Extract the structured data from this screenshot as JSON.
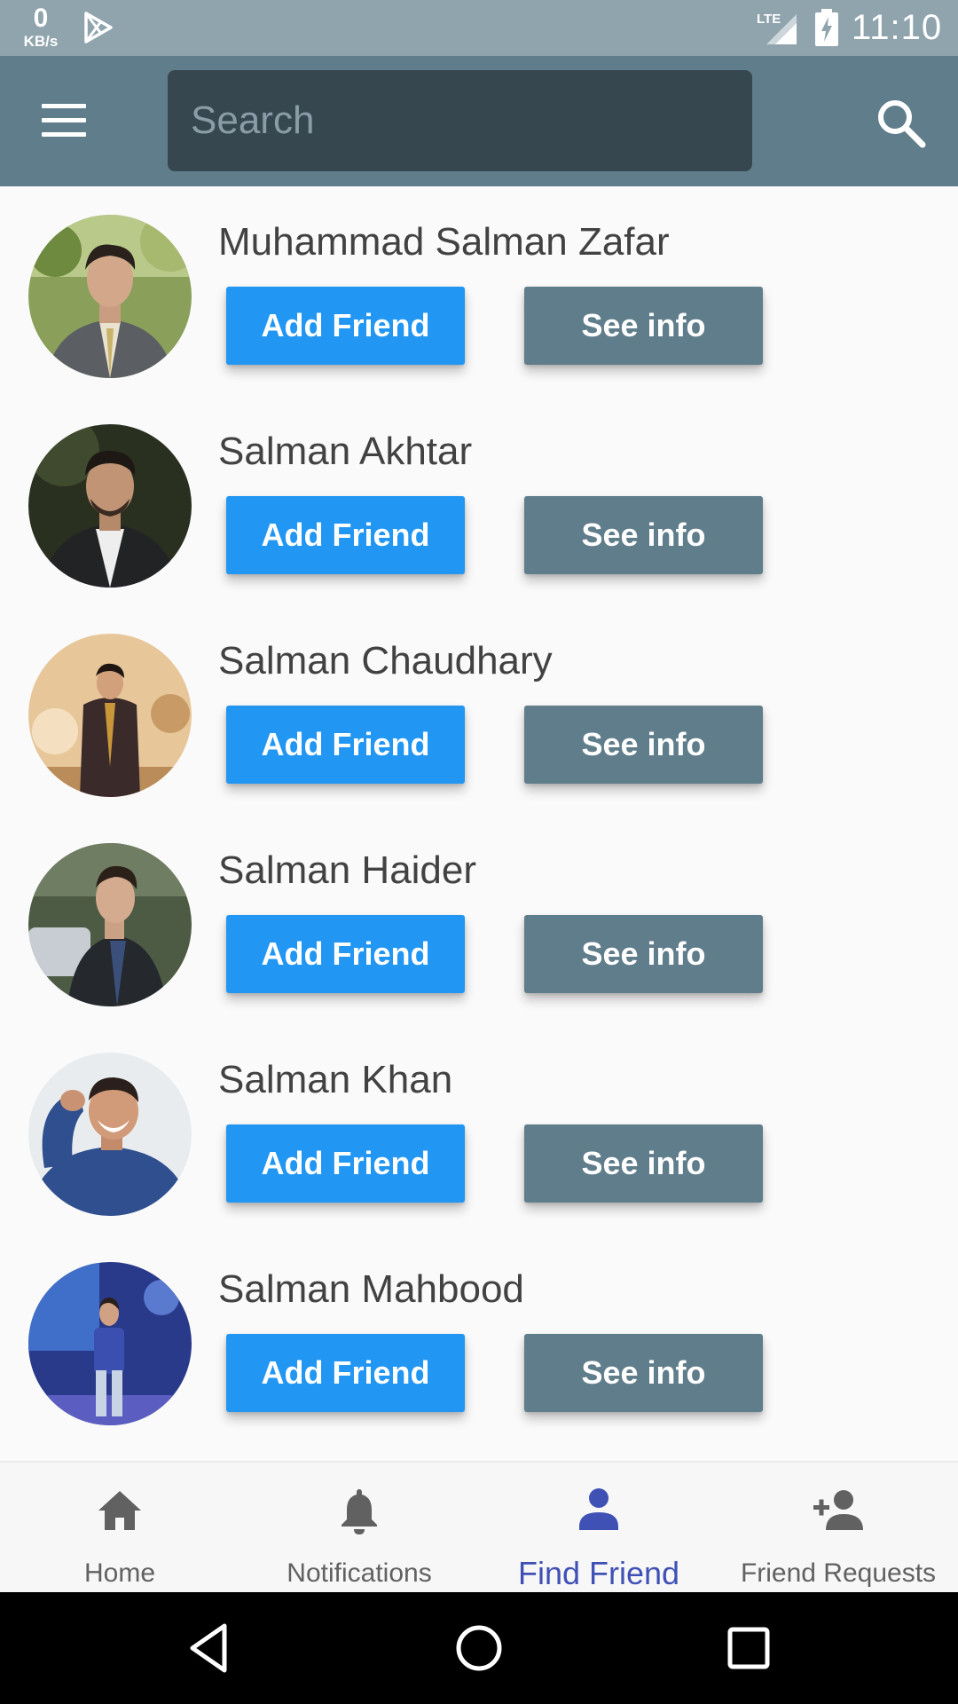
{
  "status_bar": {
    "net_speed_value": "0",
    "net_speed_unit": "KB/s",
    "network": "LTE",
    "time": "11:10",
    "icons": [
      "play-store-icon",
      "lte-signal-icon",
      "battery-charging-icon"
    ]
  },
  "app_bar": {
    "menu_icon": "hamburger-menu-icon",
    "search_placeholder": "Search",
    "search_value": "",
    "search_icon": "search-icon"
  },
  "friends": [
    {
      "name": "Muhammad Salman Zafar",
      "add_label": "Add Friend",
      "info_label": "See info"
    },
    {
      "name": "Salman Akhtar",
      "add_label": "Add Friend",
      "info_label": "See info"
    },
    {
      "name": "Salman Chaudhary",
      "add_label": "Add Friend",
      "info_label": "See info"
    },
    {
      "name": "Salman Haider",
      "add_label": "Add Friend",
      "info_label": "See info"
    },
    {
      "name": "Salman Khan",
      "add_label": "Add Friend",
      "info_label": "See info"
    },
    {
      "name": "Salman Mahbood",
      "add_label": "Add Friend",
      "info_label": "See info"
    }
  ],
  "bottom_nav": {
    "active": "Find Friend",
    "items": [
      {
        "label": "Home",
        "icon": "home-icon"
      },
      {
        "label": "Notifications",
        "icon": "bell-icon"
      },
      {
        "label": "Find Friend",
        "icon": "person-icon"
      },
      {
        "label": "Friend Requests",
        "icon": "person-add-icon"
      }
    ]
  },
  "colors": {
    "status_bar": "#90a4ae",
    "app_bar": "#607d8b",
    "search_box": "#37474f",
    "add_button": "#2196f3",
    "info_button": "#607d8b",
    "active_nav": "#3f51b5"
  }
}
